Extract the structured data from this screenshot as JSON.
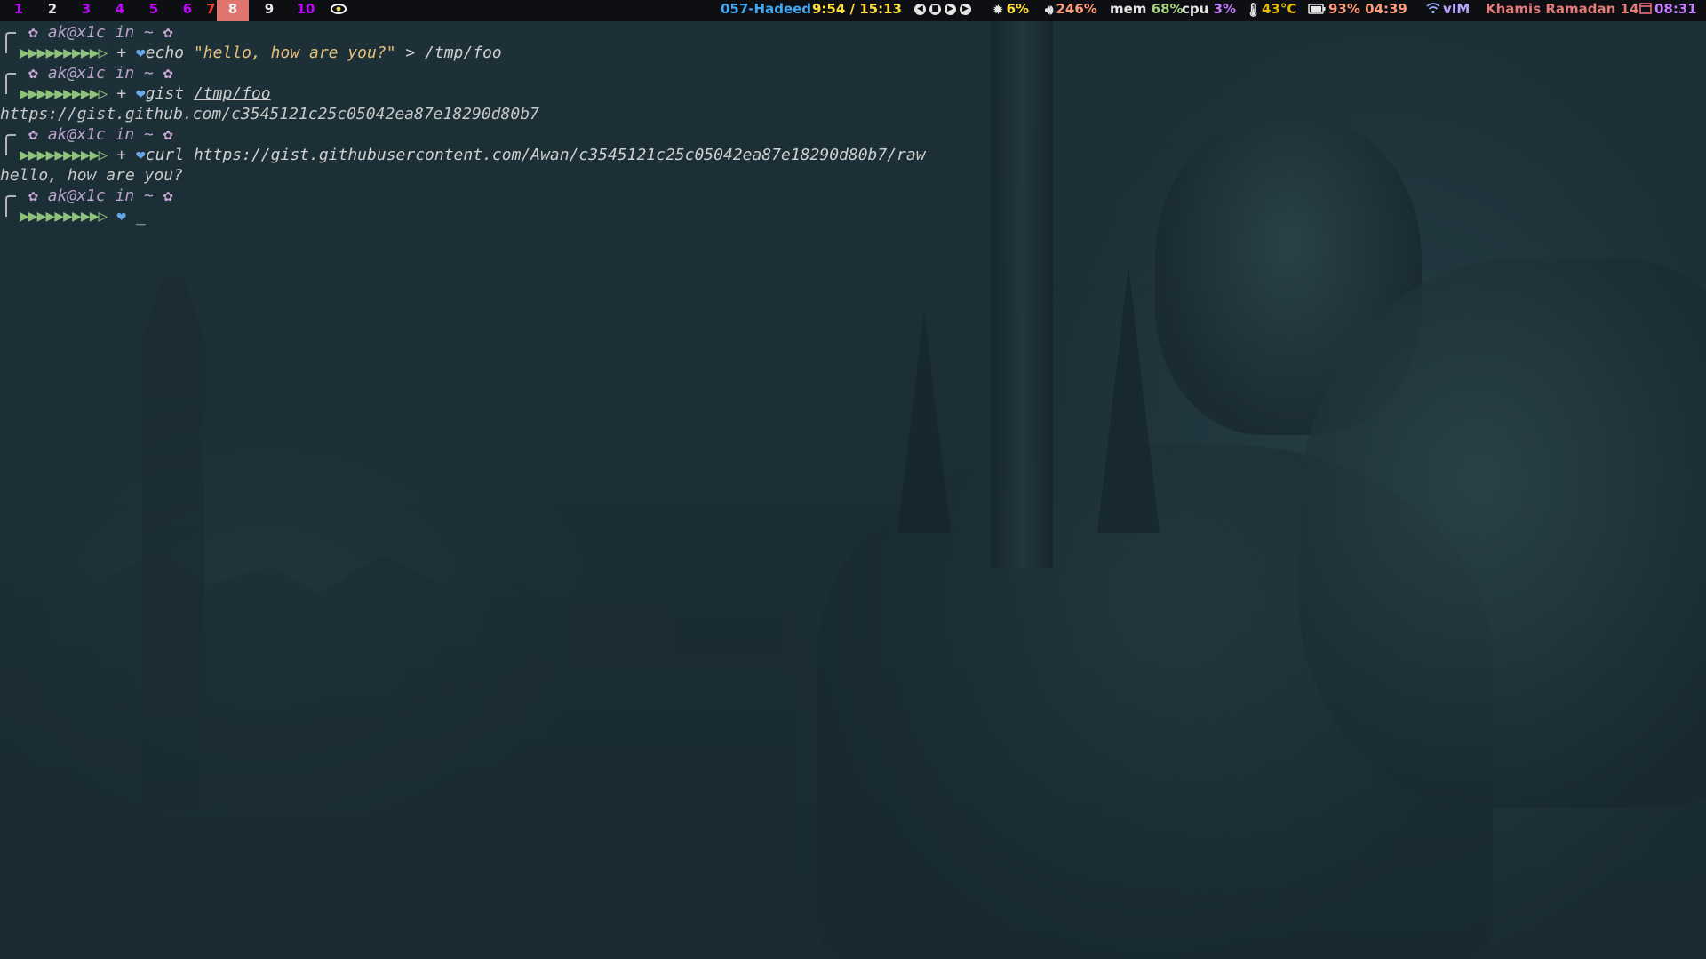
{
  "workspaces": [
    {
      "label": "1",
      "color": "#c400ff"
    },
    {
      "label": "2",
      "color": "#e6e6e6"
    },
    {
      "label": "3",
      "color": "#c400ff"
    },
    {
      "label": "4",
      "color": "#c400ff"
    },
    {
      "label": "5",
      "color": "#c400ff"
    },
    {
      "label": "6",
      "color": "#c400ff"
    },
    {
      "label": "7",
      "color": "#ff3b3b"
    },
    {
      "label": "8",
      "color": "#f2f2f2"
    },
    {
      "label": "9",
      "color": "#e6e6e6"
    },
    {
      "label": "10",
      "color": "#c400ff"
    }
  ],
  "status": {
    "eye_icon": "eye-icon",
    "track": "057-Hadeed",
    "track_time": "9:54 / 15:13",
    "brightness": "6%",
    "volume": "246%",
    "mem_label": "mem",
    "mem_value": "68%",
    "cpu_label": "cpu",
    "cpu_value": "3%",
    "temperature": "43°C",
    "battery": "93% 04:39",
    "wifi": "vIM",
    "hijri_date": "Khamis Ramadan 14",
    "clock": "08:31"
  },
  "colors": {
    "accent_active_ws": "#e0746e",
    "track": "#3fa9f5",
    "track_time": "#ffe135",
    "prompt_arrows": "#8fc27a",
    "heart": "#6aa7e8",
    "string": "#e5c07b"
  },
  "terminal": {
    "prompt_user": "ak@x1c in ~",
    "prompt_arrows": "▶▶▶▶▶▶▶▶▶▷",
    "plus": "+",
    "cmd1_name": "echo",
    "cmd1_string": "\"hello, how are you?\"",
    "cmd1_rest": "> /tmp/foo",
    "cmd2_name": "gist",
    "cmd2_arg": "/tmp/foo",
    "out2": "https://gist.github.com/c3545121c25c05042ea87e18290d80b7",
    "cmd3_name": "curl",
    "cmd3_arg": "https://gist.githubusercontent.com/Awan/c3545121c25c05042ea87e18290d80b7/raw",
    "out3": "hello, how are you?",
    "cursor": "_"
  }
}
